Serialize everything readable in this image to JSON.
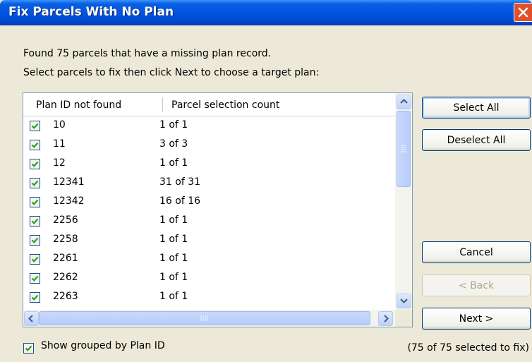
{
  "window": {
    "title": "Fix Parcels With No Plan"
  },
  "message": {
    "line1": "Found 75 parcels that have a missing plan record.",
    "line2": "Select parcels to fix then click Next to choose a target plan:"
  },
  "list": {
    "columns": [
      "Plan ID not found",
      "Parcel selection count"
    ],
    "rows": [
      {
        "checked": true,
        "plan_id": "10",
        "count": "1 of 1"
      },
      {
        "checked": true,
        "plan_id": "11",
        "count": "3 of 3"
      },
      {
        "checked": true,
        "plan_id": "12",
        "count": "1 of 1"
      },
      {
        "checked": true,
        "plan_id": "12341",
        "count": "31 of 31"
      },
      {
        "checked": true,
        "plan_id": "12342",
        "count": "16 of 16"
      },
      {
        "checked": true,
        "plan_id": "2256",
        "count": "1 of 1"
      },
      {
        "checked": true,
        "plan_id": "2258",
        "count": "1 of 1"
      },
      {
        "checked": true,
        "plan_id": "2261",
        "count": "1 of 1"
      },
      {
        "checked": true,
        "plan_id": "2262",
        "count": "1 of 1"
      },
      {
        "checked": true,
        "plan_id": "2263",
        "count": "1 of 1"
      }
    ]
  },
  "buttons": {
    "select_all": "Select All",
    "deselect_all": "Deselect All",
    "cancel": "Cancel",
    "back": "< Back",
    "next": "Next >"
  },
  "options": {
    "show_grouped_label": "Show grouped by Plan ID",
    "show_grouped_checked": true
  },
  "status": "(75 of 75 selected to fix)",
  "colors": {
    "title_bar": "#0054e3",
    "dialog_bg": "#ece9d8",
    "check": "#21a121",
    "close": "#e0502a"
  }
}
